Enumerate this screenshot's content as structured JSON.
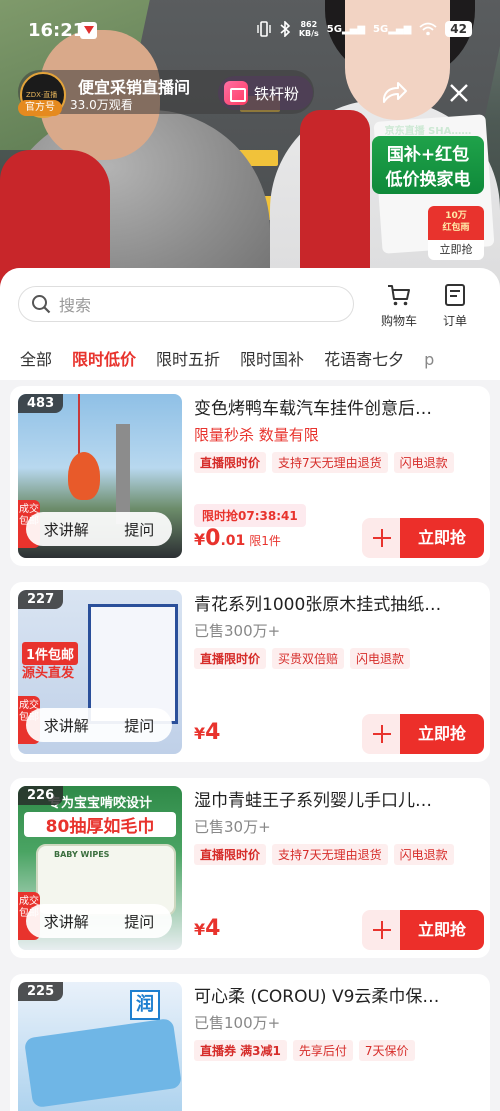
{
  "status_bar": {
    "time": "16:21",
    "net_speed_value": "862",
    "net_speed_unit": "KB/s",
    "signal1": "5G",
    "signal2": "5G",
    "battery": "42"
  },
  "live": {
    "host_name": "便宜采销直播间",
    "viewers": "33.0万观看",
    "official_tag": "官方号",
    "fan_button": "铁杆粉",
    "promo_top": "京东直播 SHA……",
    "promo_line1": "国补+红包",
    "promo_line2": "低价换家电",
    "redpack_amount": "10万",
    "redpack_label": "红包雨",
    "redpack_action": "立即抢"
  },
  "panel": {
    "search_placeholder": "搜索",
    "cart_label": "购物车",
    "orders_label": "订单",
    "tabs": [
      "全部",
      "限时低价",
      "限时五折",
      "限时国补",
      "花语寄七夕",
      "p"
    ],
    "active_tab": 1
  },
  "products": [
    {
      "rank": "483",
      "title": "变色烤鸭车载汽车挂件创意后…",
      "subtitle": "限量秒杀 数量有限",
      "tags": [
        "直播限时价",
        "支持7天无理由退货",
        "闪电退款"
      ],
      "timer": "限时抢07:38:41",
      "price_yen": "¥",
      "price_int": "0",
      "price_dec": ".01",
      "price_note": "限1件",
      "explain": "求讲解",
      "ask": "提问",
      "buy": "立即抢",
      "side_tag": "成交 包邮"
    },
    {
      "rank": "227",
      "title": "青花系列1000张原木挂式抽纸…",
      "subtitle": "已售300万+",
      "tags": [
        "直播限时价",
        "买贵双倍赔",
        "闪电退款"
      ],
      "price_yen": "¥",
      "price_int": "4",
      "explain": "求讲解",
      "ask": "提问",
      "buy": "立即抢",
      "side_tag": "成交 包邮"
    },
    {
      "rank": "226",
      "title": "湿巾青蛙王子系列婴儿手口儿…",
      "subtitle": "已售30万+",
      "tags": [
        "直播限时价",
        "支持7天无理由退货",
        "闪电退款"
      ],
      "price_yen": "¥",
      "price_int": "4",
      "explain": "求讲解",
      "ask": "提问",
      "buy": "立即抢",
      "side_tag": "成交 包邮"
    },
    {
      "rank": "225",
      "title": "可心柔 (COROU) V9云柔巾保…",
      "subtitle": "已售100万+",
      "tags": [
        "直播券 满3减1",
        "先享后付",
        "7天保价"
      ],
      "price_yen": "¥",
      "price_int": "",
      "explain": "求讲解",
      "ask": "提问",
      "buy": "立即抢",
      "side_tag": ""
    }
  ],
  "thumb_texts": {
    "p2_headline1": "1件包邮",
    "p2_headline2": "源头直发",
    "p3_headline1": "专为宝宝啃咬设计",
    "p3_headline2": "80抽厚如毛巾",
    "p3_pack": "BABY WIPES",
    "p4_brand": "润"
  }
}
